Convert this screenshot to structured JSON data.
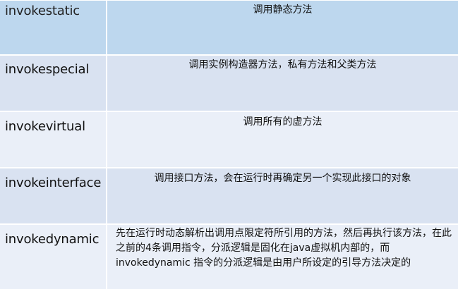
{
  "rows": [
    {
      "instruction": "invokestatic",
      "description": "调用静态方法"
    },
    {
      "instruction": "invokespecial",
      "description": "调用实例构造器方法，私有方法和父类方法"
    },
    {
      "instruction": "invokevirtual",
      "description": "调用所有的虚方法"
    },
    {
      "instruction": "invokeinterface",
      "description": "调用接口方法，会在运行时再确定另一个实现此接口的对象"
    },
    {
      "instruction": "invokedynamic",
      "description": "先在运行时动态解析出调用点限定符所引用的方法，然后再执行该方法，在此之前的4条调用指令，分派逻辑是固化在java虚拟机内部的，而 invokedynamic 指令的分派逻辑是由用户所设定的引导方法决定的"
    }
  ]
}
